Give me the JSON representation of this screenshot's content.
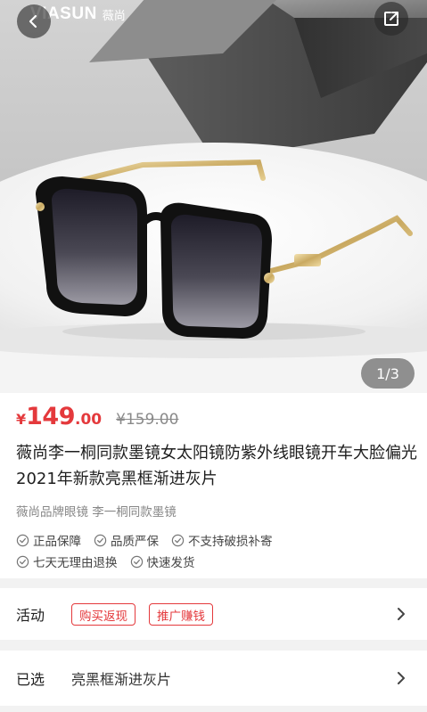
{
  "hero": {
    "brand_logo": "VIASUN",
    "brand_cn": "薇尚",
    "pager": "1/3"
  },
  "product": {
    "currency": "¥",
    "price_int": "149",
    "price_dec": ".00",
    "original_price": "¥159.00",
    "title": "薇尚李一桐同款墨镜女太阳镜防紫外线眼镜开车大脸偏光2021年新款亮黑框渐进灰片",
    "subtitle": "薇尚品牌眼镜 李一桐同款墨镜",
    "badges_row1": [
      "正品保障",
      "品质严保",
      "不支持破损补寄"
    ],
    "badges_row2": [
      "七天无理由退换",
      "快速发货"
    ]
  },
  "activity": {
    "label": "活动",
    "tags": [
      "购买返现",
      "推广赚钱"
    ]
  },
  "selected": {
    "label": "已选",
    "value": "亮黑框渐进灰片"
  },
  "colors": {
    "accent": "#e4393c"
  },
  "icons": [
    "back-arrow-icon",
    "share-icon",
    "check-circle-icon",
    "chevron-right-icon"
  ]
}
